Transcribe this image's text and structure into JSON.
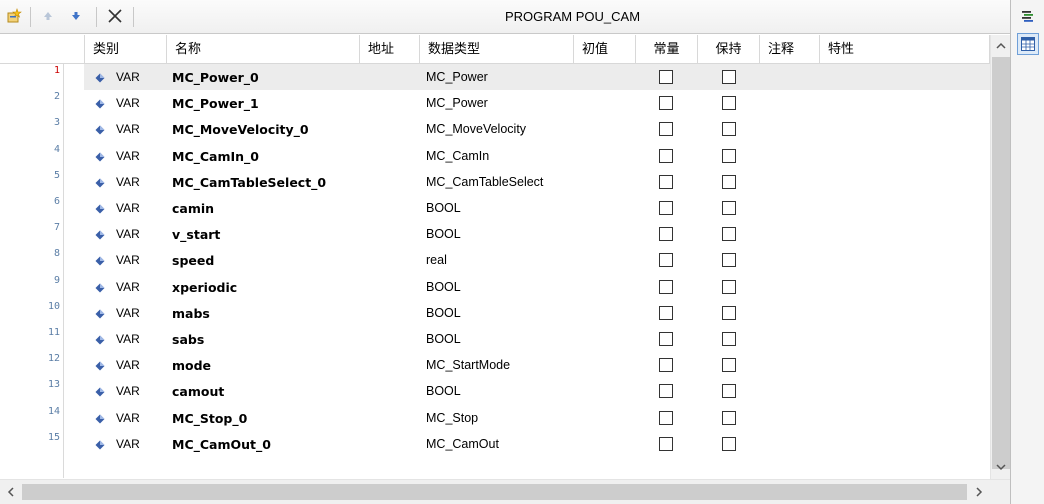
{
  "window": {
    "title": "PROGRAM POU_CAM"
  },
  "toolbar": {
    "buttons": [
      "add-variable-icon",
      "move-up-icon",
      "move-down-icon",
      "delete-icon"
    ]
  },
  "columns": {
    "category": "类别",
    "name": "名称",
    "address": "地址",
    "datatype": "数据类型",
    "initial": "初值",
    "constant": "常量",
    "retain": "保持",
    "comment": "注释",
    "attributes": "特性"
  },
  "rows": [
    {
      "num": "1",
      "cat": "VAR",
      "name": "MC_Power_0",
      "type": "MC_Power",
      "constant": false,
      "retain": false
    },
    {
      "num": "2",
      "cat": "VAR",
      "name": "MC_Power_1",
      "type": "MC_Power",
      "constant": false,
      "retain": false
    },
    {
      "num": "3",
      "cat": "VAR",
      "name": "MC_MoveVelocity_0",
      "type": "MC_MoveVelocity",
      "constant": false,
      "retain": false
    },
    {
      "num": "4",
      "cat": "VAR",
      "name": "MC_CamIn_0",
      "type": "MC_CamIn",
      "constant": false,
      "retain": false
    },
    {
      "num": "5",
      "cat": "VAR",
      "name": "MC_CamTableSelect_0",
      "type": "MC_CamTableSelect",
      "constant": false,
      "retain": false
    },
    {
      "num": "6",
      "cat": "VAR",
      "name": "camin",
      "type": "BOOL",
      "constant": false,
      "retain": false
    },
    {
      "num": "7",
      "cat": "VAR",
      "name": "v_start",
      "type": "BOOL",
      "constant": false,
      "retain": false
    },
    {
      "num": "8",
      "cat": "VAR",
      "name": "speed",
      "type": "real",
      "constant": false,
      "retain": false
    },
    {
      "num": "9",
      "cat": "VAR",
      "name": "xperiodic",
      "type": "BOOL",
      "constant": false,
      "retain": false
    },
    {
      "num": "10",
      "cat": "VAR",
      "name": "mabs",
      "type": "BOOL",
      "constant": false,
      "retain": false
    },
    {
      "num": "11",
      "cat": "VAR",
      "name": "sabs",
      "type": "BOOL",
      "constant": false,
      "retain": false
    },
    {
      "num": "12",
      "cat": "VAR",
      "name": "mode",
      "type": "MC_StartMode",
      "constant": false,
      "retain": false
    },
    {
      "num": "13",
      "cat": "VAR",
      "name": "camout",
      "type": "BOOL",
      "constant": false,
      "retain": false
    },
    {
      "num": "14",
      "cat": "VAR",
      "name": "MC_Stop_0",
      "type": "MC_Stop",
      "constant": false,
      "retain": false
    },
    {
      "num": "15",
      "cat": "VAR",
      "name": "MC_CamOut_0",
      "type": "MC_CamOut",
      "constant": false,
      "retain": false
    }
  ],
  "selected_row": 0,
  "sidepanel": {
    "buttons": [
      "textual-view-icon",
      "tabular-view-icon"
    ],
    "active": "tabular-view-icon"
  },
  "colors": {
    "selected_row": "#ececec",
    "line_number": "#5b7ea6",
    "first_line_number": "#cc0000",
    "var_icon": "#3a5fa8"
  }
}
